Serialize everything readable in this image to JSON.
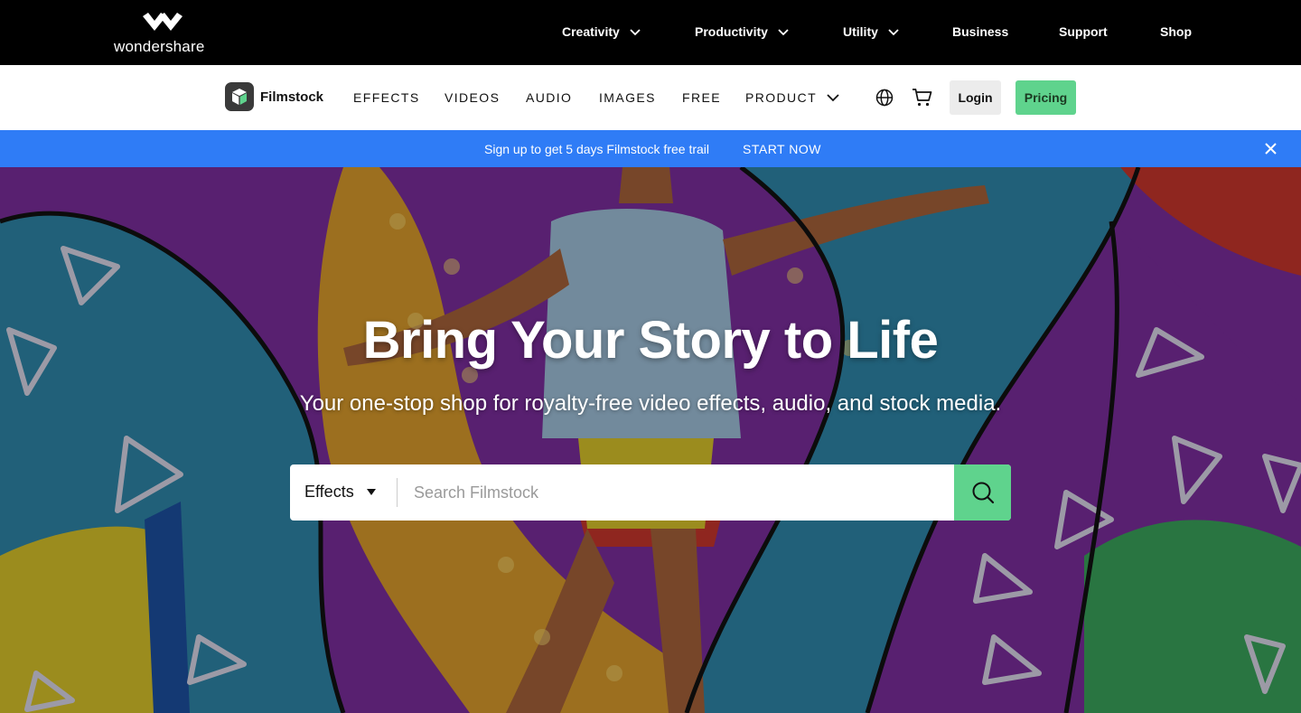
{
  "brand": {
    "name": "wondershare"
  },
  "topnav": {
    "items": [
      {
        "label": "Creativity",
        "dropdown": true
      },
      {
        "label": "Productivity",
        "dropdown": true
      },
      {
        "label": "Utility",
        "dropdown": true
      },
      {
        "label": "Business",
        "dropdown": false
      },
      {
        "label": "Support",
        "dropdown": false
      },
      {
        "label": "Shop",
        "dropdown": false
      }
    ]
  },
  "subnav": {
    "product_name": "Filmstock",
    "items": [
      {
        "label": "EFFECTS"
      },
      {
        "label": "VIDEOS"
      },
      {
        "label": "AUDIO"
      },
      {
        "label": "IMAGES"
      },
      {
        "label": "FREE"
      },
      {
        "label": "PRODUCT",
        "dropdown": true
      }
    ],
    "icons": [
      "globe-icon",
      "cart-icon"
    ],
    "login_label": "Login",
    "pricing_label": "Pricing"
  },
  "promo": {
    "message": "Sign up to get 5 days Filmstock free trail",
    "cta": "START NOW"
  },
  "hero": {
    "title": "Bring Your Story to Life",
    "subtitle": "Your one-stop shop for royalty-free video effects, audio, and stock media.",
    "search": {
      "category": "Effects",
      "placeholder": "Search Filmstock"
    }
  },
  "colors": {
    "accent_green": "#5fd38d",
    "promo_blue": "#2f7cf6",
    "topbar_black": "#000000"
  }
}
